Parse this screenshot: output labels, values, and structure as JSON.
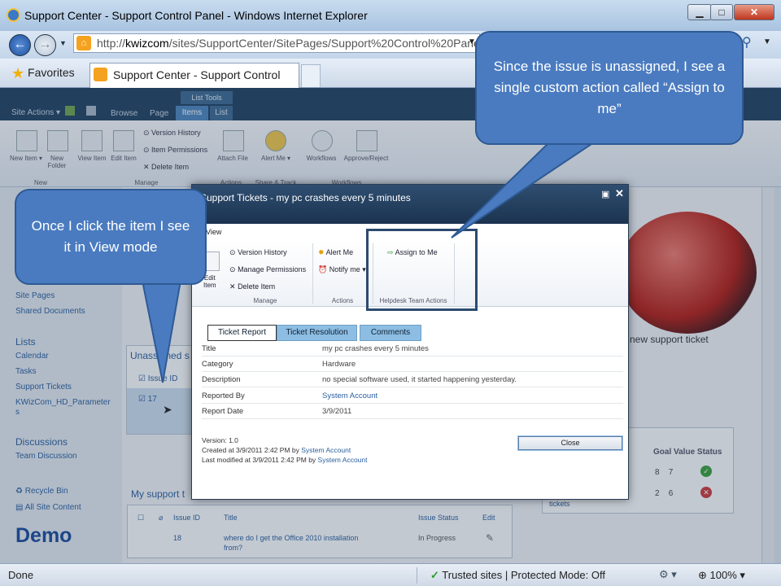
{
  "browser": {
    "window_title": "Support Center - Support Control Panel - Windows Internet Explorer",
    "url_prefix": "http://",
    "url_domain": "kwizcom",
    "url_rest": "/sites/SupportCenter/SitePages/Support%20Control%20Panel.a",
    "favorites_label": "Favorites",
    "tab_title": "Support Center - Support Control Panel",
    "status_text": "Done",
    "zone_text": "Trusted sites | Protected Mode: Off",
    "zoom_text": "100%"
  },
  "sharepoint": {
    "site_actions": "Site Actions ▾",
    "tabs": {
      "browse": "Browse",
      "page": "Page",
      "items": "Items",
      "list": "List"
    },
    "list_tools": "List Tools",
    "ribbon": {
      "new_item": "New Item ▾",
      "new_folder": "New Folder",
      "view_item": "View Item",
      "edit_item": "Edit Item",
      "version_history": "Version History",
      "item_permissions": "Item Permissions",
      "delete_item": "Delete Item",
      "attach_file": "Attach File",
      "alert_me": "Alert Me ▾",
      "workflows": "Workflows",
      "approve_reject": "Approve/Reject",
      "group_new": "New",
      "group_manage": "Manage",
      "group_actions": "Actions",
      "group_share": "Share & Track",
      "group_workflows": "Workflows"
    },
    "left_nav": {
      "site_pages": "Site Pages",
      "shared_documents": "Shared Documents",
      "lists_header": "Lists",
      "calendar": "Calendar",
      "tasks": "Tasks",
      "support_tickets": "Support Tickets",
      "kwizcom_params": "KWizCom_HD_Parameter",
      "kwizcom_params_2": "s",
      "discussions_header": "Discussions",
      "team_discussion": "Team Discussion",
      "recycle_bin": "Recycle Bin",
      "all_site_content": "All Site Content"
    },
    "demo_label": "Demo",
    "unassigned_header": "Unassigned s",
    "issue_id_header": "Issue ID",
    "unassigned_id": "17",
    "new_ticket_text": "new support ticket",
    "goal_header": "Goal Value Status",
    "goal_rows": [
      {
        "goal": "8",
        "value": "7"
      },
      {
        "goal": "2",
        "value": "6"
      }
    ],
    "goal_tickets": "tickets",
    "my_support_header": "My support t",
    "bottom_table": {
      "headers": {
        "issue_id": "Issue ID",
        "title": "Title",
        "status": "Issue Status",
        "edit": "Edit"
      },
      "row": {
        "id": "18",
        "title_1": "where do I get the Office 2010 installation",
        "title_2": "from?",
        "status": "In Progress"
      }
    }
  },
  "modal": {
    "title": "Support Tickets - my pc crashes every 5 minutes",
    "view_tab": "View",
    "ribbon": {
      "edit_item": "Edit",
      "edit_item_2": "Item",
      "version_history": "Version History",
      "manage_permissions": "Manage Permissions",
      "delete_item": "Delete Item",
      "alert_me": "Alert Me",
      "notify_me": "Notify me ▾",
      "assign_to_me": "Assign to Me",
      "group_manage": "Manage",
      "group_actions": "Actions",
      "group_helpdesk": "Helpdesk Team Actions"
    },
    "form_tabs": {
      "report": "Ticket Report",
      "resolution": "Ticket Resolution",
      "comments": "Comments"
    },
    "fields": [
      {
        "label": "Title",
        "value": "my pc crashes every 5 minutes",
        "link": false
      },
      {
        "label": "Category",
        "value": "Hardware",
        "link": false
      },
      {
        "label": "Description",
        "value": "no special software used, it started happening yesterday.",
        "link": false
      },
      {
        "label": "Reported By",
        "value": "System Account",
        "link": true
      },
      {
        "label": "Report Date",
        "value": "3/9/2011",
        "link": false
      }
    ],
    "version_text": "Version: 1.0",
    "created_prefix": "Created at 3/9/2011 2:42 PM by ",
    "modified_prefix": "Last modified at 3/9/2011 2:42 PM by ",
    "account": "System Account",
    "close_label": "Close"
  },
  "callouts": {
    "right": "Since the issue is unassigned, I see a single custom action called “Assign to me”",
    "left": "Once I click the item I see it in View mode"
  },
  "colors": {
    "callout": "#4a7bc0",
    "ribbon_dark": "#21405f",
    "link": "#2a5f9e"
  }
}
